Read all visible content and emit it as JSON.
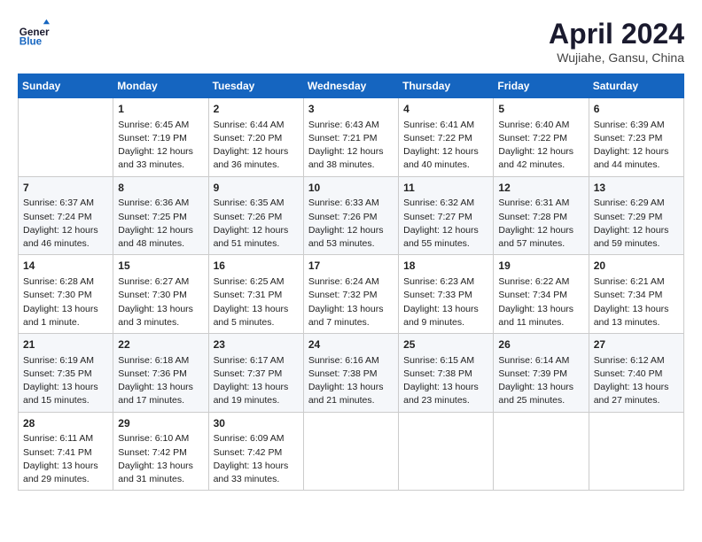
{
  "header": {
    "logo_line1": "General",
    "logo_line2": "Blue",
    "month": "April 2024",
    "location": "Wujiahe, Gansu, China"
  },
  "days_of_week": [
    "Sunday",
    "Monday",
    "Tuesday",
    "Wednesday",
    "Thursday",
    "Friday",
    "Saturday"
  ],
  "weeks": [
    [
      {
        "day": "",
        "info": ""
      },
      {
        "day": "1",
        "info": "Sunrise: 6:45 AM\nSunset: 7:19 PM\nDaylight: 12 hours\nand 33 minutes."
      },
      {
        "day": "2",
        "info": "Sunrise: 6:44 AM\nSunset: 7:20 PM\nDaylight: 12 hours\nand 36 minutes."
      },
      {
        "day": "3",
        "info": "Sunrise: 6:43 AM\nSunset: 7:21 PM\nDaylight: 12 hours\nand 38 minutes."
      },
      {
        "day": "4",
        "info": "Sunrise: 6:41 AM\nSunset: 7:22 PM\nDaylight: 12 hours\nand 40 minutes."
      },
      {
        "day": "5",
        "info": "Sunrise: 6:40 AM\nSunset: 7:22 PM\nDaylight: 12 hours\nand 42 minutes."
      },
      {
        "day": "6",
        "info": "Sunrise: 6:39 AM\nSunset: 7:23 PM\nDaylight: 12 hours\nand 44 minutes."
      }
    ],
    [
      {
        "day": "7",
        "info": "Sunrise: 6:37 AM\nSunset: 7:24 PM\nDaylight: 12 hours\nand 46 minutes."
      },
      {
        "day": "8",
        "info": "Sunrise: 6:36 AM\nSunset: 7:25 PM\nDaylight: 12 hours\nand 48 minutes."
      },
      {
        "day": "9",
        "info": "Sunrise: 6:35 AM\nSunset: 7:26 PM\nDaylight: 12 hours\nand 51 minutes."
      },
      {
        "day": "10",
        "info": "Sunrise: 6:33 AM\nSunset: 7:26 PM\nDaylight: 12 hours\nand 53 minutes."
      },
      {
        "day": "11",
        "info": "Sunrise: 6:32 AM\nSunset: 7:27 PM\nDaylight: 12 hours\nand 55 minutes."
      },
      {
        "day": "12",
        "info": "Sunrise: 6:31 AM\nSunset: 7:28 PM\nDaylight: 12 hours\nand 57 minutes."
      },
      {
        "day": "13",
        "info": "Sunrise: 6:29 AM\nSunset: 7:29 PM\nDaylight: 12 hours\nand 59 minutes."
      }
    ],
    [
      {
        "day": "14",
        "info": "Sunrise: 6:28 AM\nSunset: 7:30 PM\nDaylight: 13 hours\nand 1 minute."
      },
      {
        "day": "15",
        "info": "Sunrise: 6:27 AM\nSunset: 7:30 PM\nDaylight: 13 hours\nand 3 minutes."
      },
      {
        "day": "16",
        "info": "Sunrise: 6:25 AM\nSunset: 7:31 PM\nDaylight: 13 hours\nand 5 minutes."
      },
      {
        "day": "17",
        "info": "Sunrise: 6:24 AM\nSunset: 7:32 PM\nDaylight: 13 hours\nand 7 minutes."
      },
      {
        "day": "18",
        "info": "Sunrise: 6:23 AM\nSunset: 7:33 PM\nDaylight: 13 hours\nand 9 minutes."
      },
      {
        "day": "19",
        "info": "Sunrise: 6:22 AM\nSunset: 7:34 PM\nDaylight: 13 hours\nand 11 minutes."
      },
      {
        "day": "20",
        "info": "Sunrise: 6:21 AM\nSunset: 7:34 PM\nDaylight: 13 hours\nand 13 minutes."
      }
    ],
    [
      {
        "day": "21",
        "info": "Sunrise: 6:19 AM\nSunset: 7:35 PM\nDaylight: 13 hours\nand 15 minutes."
      },
      {
        "day": "22",
        "info": "Sunrise: 6:18 AM\nSunset: 7:36 PM\nDaylight: 13 hours\nand 17 minutes."
      },
      {
        "day": "23",
        "info": "Sunrise: 6:17 AM\nSunset: 7:37 PM\nDaylight: 13 hours\nand 19 minutes."
      },
      {
        "day": "24",
        "info": "Sunrise: 6:16 AM\nSunset: 7:38 PM\nDaylight: 13 hours\nand 21 minutes."
      },
      {
        "day": "25",
        "info": "Sunrise: 6:15 AM\nSunset: 7:38 PM\nDaylight: 13 hours\nand 23 minutes."
      },
      {
        "day": "26",
        "info": "Sunrise: 6:14 AM\nSunset: 7:39 PM\nDaylight: 13 hours\nand 25 minutes."
      },
      {
        "day": "27",
        "info": "Sunrise: 6:12 AM\nSunset: 7:40 PM\nDaylight: 13 hours\nand 27 minutes."
      }
    ],
    [
      {
        "day": "28",
        "info": "Sunrise: 6:11 AM\nSunset: 7:41 PM\nDaylight: 13 hours\nand 29 minutes."
      },
      {
        "day": "29",
        "info": "Sunrise: 6:10 AM\nSunset: 7:42 PM\nDaylight: 13 hours\nand 31 minutes."
      },
      {
        "day": "30",
        "info": "Sunrise: 6:09 AM\nSunset: 7:42 PM\nDaylight: 13 hours\nand 33 minutes."
      },
      {
        "day": "",
        "info": ""
      },
      {
        "day": "",
        "info": ""
      },
      {
        "day": "",
        "info": ""
      },
      {
        "day": "",
        "info": ""
      }
    ]
  ]
}
